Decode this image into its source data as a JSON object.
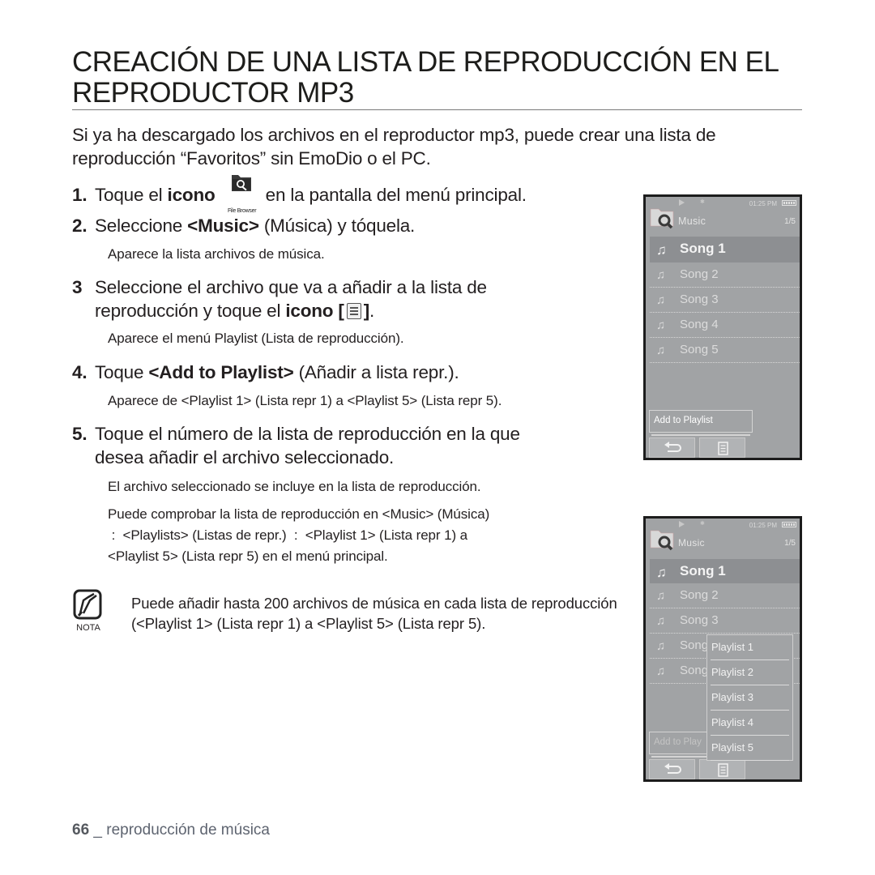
{
  "page": {
    "title": "CREACIÓN DE UNA LISTA DE REPRODUCCIÓN EN EL REPRODUCTOR MP3",
    "intro": "Si ya ha descargado los archivos en el reproductor mp3, puede crear una lista de reproducción “Favoritos” sin EmoDio o el PC."
  },
  "steps": [
    {
      "number": "1.",
      "pre": "Toque el ",
      "bold": "icono",
      "post": " en la pantalla del menú principal.",
      "icon_name": "file-browser-icon",
      "icon_caption": "File Browser"
    },
    {
      "number": "2.",
      "pre": "Seleccione ",
      "bold": "<Music>",
      "post": " (Música) y tóquela.",
      "sub": "Aparece la lista archivos de música."
    },
    {
      "number": "3",
      "line1": "Seleccione el archivo que va a añadir a la lista de",
      "line2_pre": "reproducción y toque el ",
      "bold": "icono [",
      "bold_end": "]",
      "post": ".",
      "icon_name": "menu-icon",
      "sub": "Aparece el menú Playlist (Lista de reproducción)."
    },
    {
      "number": "4.",
      "pre": "Toque ",
      "bold": "<Add to Playlist>",
      "post": " (Añadir a lista repr.).",
      "sub": "Aparece de <Playlist 1> (Lista repr 1) a <Playlist 5> (Lista repr 5)."
    },
    {
      "number": "5.",
      "line1": "Toque el número de la lista de reproducción en la que",
      "line2": "desea añadir el archivo seleccionado.",
      "sub1": "El archivo seleccionado se incluye en la lista de reproducción.",
      "sub2_line1": "Puede comprobar la lista de reproducción en <Music> (Música)",
      "sub2_line2": " :  <Playlists> (Listas de repr.)  :  <Playlist 1> (Lista repr 1) a",
      "sub2_line3": "<Playlist 5> (Lista repr 5) en el menú principal."
    }
  ],
  "note": {
    "label": "NOTA",
    "icon_name": "note-pencil-icon",
    "text": "Puede añadir hasta 200 archivos de música en cada lista de reproducción (<Playlist 1> (Lista repr 1) a <Playlist 5> (Lista repr 5)."
  },
  "footer": {
    "page_number": "66",
    "separator": " _ ",
    "section": "reproducción de música"
  },
  "screens": [
    {
      "status_time": "01:25 PM",
      "header_label": "Music",
      "header_count": "1/5",
      "songs": [
        "Song 1",
        "Song 2",
        "Song 3",
        "Song 4",
        "Song 5"
      ],
      "selected_index": 0,
      "context_item": "Add to Playlist"
    },
    {
      "status_time": "01:25 PM",
      "header_label": "Music",
      "header_count": "1/5",
      "songs": [
        "Song 1",
        "Song 2",
        "Song 3",
        "Song",
        "Song"
      ],
      "selected_index": 0,
      "context_item": "Add to Play",
      "popup_items": [
        "Playlist 1",
        "Playlist 2",
        "Playlist 3",
        "Playlist 4",
        "Playlist 5"
      ]
    }
  ]
}
